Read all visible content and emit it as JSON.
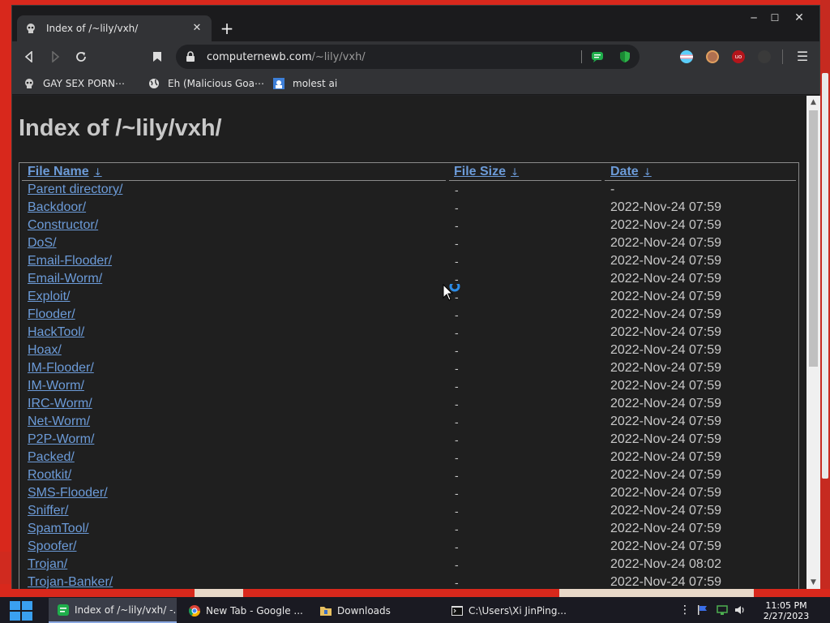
{
  "browser": {
    "tab_title": "Index of /~lily/vxh/",
    "new_tab_symbol": "+",
    "url_host": "computernewb.com",
    "url_path": "/~lily/vxh/",
    "bookmarks": [
      "GAY SEX PORN⋯",
      "Eh (Malicious Goa⋯",
      "molest ai"
    ]
  },
  "page": {
    "title": "Index of /~lily/vxh/",
    "columns": {
      "name": "File Name",
      "size": "File Size",
      "date": "Date",
      "sort_arrow": "↓"
    },
    "rows": [
      {
        "name": "Parent directory/",
        "size": "-",
        "date": "-"
      },
      {
        "name": "Backdoor/",
        "size": "-",
        "date": "2022-Nov-24 07:59"
      },
      {
        "name": "Constructor/",
        "size": "-",
        "date": "2022-Nov-24 07:59"
      },
      {
        "name": "DoS/",
        "size": "-",
        "date": "2022-Nov-24 07:59"
      },
      {
        "name": "Email-Flooder/",
        "size": "-",
        "date": "2022-Nov-24 07:59"
      },
      {
        "name": "Email-Worm/",
        "size": "-",
        "date": "2022-Nov-24 07:59"
      },
      {
        "name": "Exploit/",
        "size": "-",
        "date": "2022-Nov-24 07:59"
      },
      {
        "name": "Flooder/",
        "size": "-",
        "date": "2022-Nov-24 07:59"
      },
      {
        "name": "HackTool/",
        "size": "-",
        "date": "2022-Nov-24 07:59"
      },
      {
        "name": "Hoax/",
        "size": "-",
        "date": "2022-Nov-24 07:59"
      },
      {
        "name": "IM-Flooder/",
        "size": "-",
        "date": "2022-Nov-24 07:59"
      },
      {
        "name": "IM-Worm/",
        "size": "-",
        "date": "2022-Nov-24 07:59"
      },
      {
        "name": "IRC-Worm/",
        "size": "-",
        "date": "2022-Nov-24 07:59"
      },
      {
        "name": "Net-Worm/",
        "size": "-",
        "date": "2022-Nov-24 07:59"
      },
      {
        "name": "P2P-Worm/",
        "size": "-",
        "date": "2022-Nov-24 07:59"
      },
      {
        "name": "Packed/",
        "size": "-",
        "date": "2022-Nov-24 07:59"
      },
      {
        "name": "Rootkit/",
        "size": "-",
        "date": "2022-Nov-24 07:59"
      },
      {
        "name": "SMS-Flooder/",
        "size": "-",
        "date": "2022-Nov-24 07:59"
      },
      {
        "name": "Sniffer/",
        "size": "-",
        "date": "2022-Nov-24 07:59"
      },
      {
        "name": "SpamTool/",
        "size": "-",
        "date": "2022-Nov-24 07:59"
      },
      {
        "name": "Spoofer/",
        "size": "-",
        "date": "2022-Nov-24 07:59"
      },
      {
        "name": "Trojan/",
        "size": "-",
        "date": "2022-Nov-24 08:02"
      },
      {
        "name": "Trojan-Banker/",
        "size": "-",
        "date": "2022-Nov-24 07:59"
      }
    ]
  },
  "taskbar": {
    "items": [
      {
        "label": "Index of /~lily/vxh/ -...",
        "icon": "chrome-dev-icon"
      },
      {
        "label": "New Tab - Google ...",
        "icon": "chrome-icon"
      },
      {
        "label": "Downloads",
        "icon": "folder-icon"
      },
      {
        "label": "C:\\Users\\Xi JinPing...",
        "icon": "terminal-icon"
      }
    ],
    "clock_time": "11:05 PM",
    "clock_date": "2/27/2023"
  },
  "colors": {
    "link": "#6c9bd8",
    "desktop": "#d8281c",
    "page_bg": "#1f1f1f"
  }
}
